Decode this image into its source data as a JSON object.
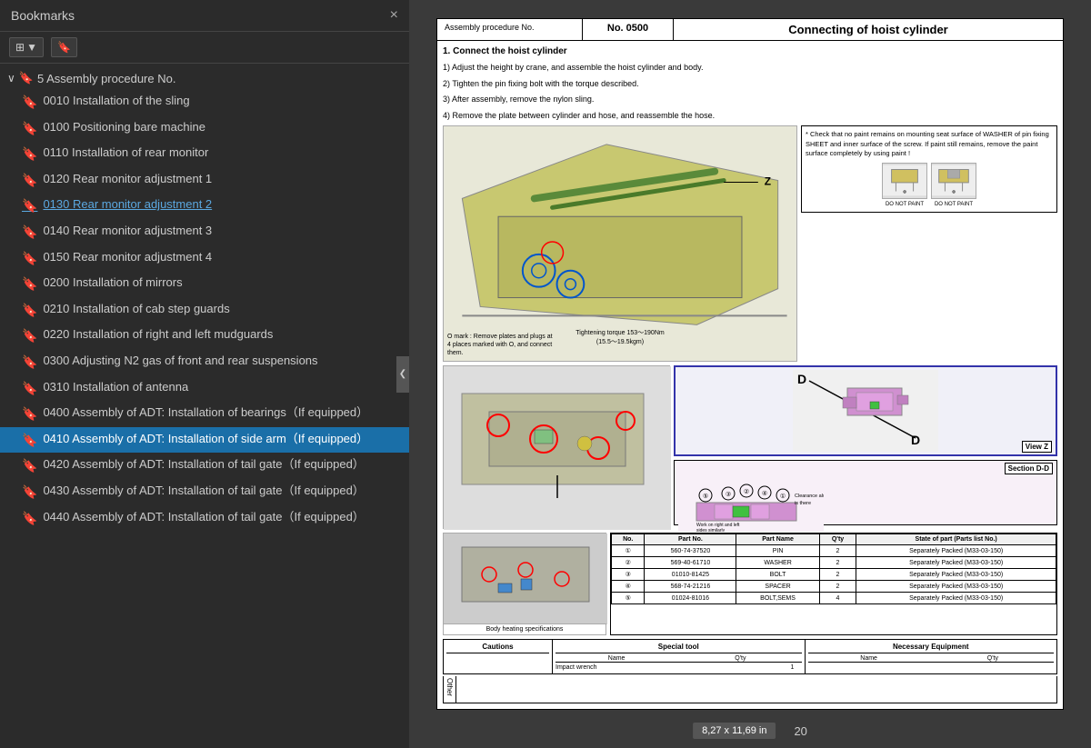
{
  "bookmarks": {
    "title": "Bookmarks",
    "close_label": "×",
    "root_label": "5 Assembly procedure No.",
    "items": [
      {
        "id": "b0010",
        "label": "0010 Installation of the sling",
        "active": false,
        "linked": false
      },
      {
        "id": "b0100",
        "label": "0100 Positioning bare machine",
        "active": false,
        "linked": false
      },
      {
        "id": "b0110",
        "label": "0110 Installation of rear monitor",
        "active": false,
        "linked": false
      },
      {
        "id": "b0120",
        "label": "0120 Rear monitor adjustment 1",
        "active": false,
        "linked": false
      },
      {
        "id": "b0130",
        "label": "0130 Rear monitor adjustment 2",
        "active": false,
        "linked": true
      },
      {
        "id": "b0140",
        "label": "0140 Rear monitor adjustment 3",
        "active": false,
        "linked": false
      },
      {
        "id": "b0150",
        "label": "0150 Rear monitor adjustment 4",
        "active": false,
        "linked": false
      },
      {
        "id": "b0200",
        "label": "0200 Installation of mirrors",
        "active": false,
        "linked": false
      },
      {
        "id": "b0210",
        "label": "0210 Installation of cab step guards",
        "active": false,
        "linked": false
      },
      {
        "id": "b0220",
        "label": "0220 Installation of right and left mudguards",
        "active": false,
        "linked": false
      },
      {
        "id": "b0300",
        "label": "0300 Adjusting N2 gas of front and rear suspensions",
        "active": false,
        "linked": false
      },
      {
        "id": "b0310",
        "label": "0310 Installation of antenna",
        "active": false,
        "linked": false
      },
      {
        "id": "b0400",
        "label": "0400 Assembly of ADT: Installation of bearings（If equipped）",
        "active": false,
        "linked": false
      },
      {
        "id": "b0410",
        "label": "0410 Assembly of ADT: Installation of side arm（If equipped）",
        "active": true,
        "linked": false
      },
      {
        "id": "b0420",
        "label": "0420 Assembly of ADT: Installation of tail gate（If equipped）",
        "active": false,
        "linked": false
      },
      {
        "id": "b0430",
        "label": "0430 Assembly of ADT: Installation of tail gate（If equipped）",
        "active": false,
        "linked": false
      },
      {
        "id": "b0440",
        "label": "0440 Assembly of ADT: Installation of tail gate（If equipped）",
        "active": false,
        "linked": false
      }
    ]
  },
  "document": {
    "header": {
      "proc_label": "Assembly procedure No.",
      "no_label": "No. 0500",
      "title": "Connecting of hoist cylinder"
    },
    "section1_title": "1. Connect the hoist cylinder",
    "instructions": [
      "1) Adjust the height by crane, and assemble the hoist cylinder and body.",
      "2) Tighten the pin fixing bolt with the torque described.",
      "3) After assembly, remove the nylon sling.",
      "4) Remove the plate between cylinder and hose, and reassemble the hose."
    ],
    "note_text": "* Check that no paint remains on mounting seat surface of WASHER of pin fixing SHEET and inner surface of the screw. If paint still remains, remove the paint surface completely by using paint !",
    "note_labels": [
      "DO NOT PAINT",
      "DO NOT PAINT"
    ],
    "torque_text": "Tightening torque  153～190Nm\n(15.5～19.5kgm)",
    "o_mark_text": "O mark : Remove plates and plugs at\n4 places marked with O, and connect\nthem.",
    "view_z_label": "View Z",
    "d_label": "D",
    "section_dd_label": "Section D-D",
    "clearance_text": "Clearance always\nis there",
    "work_text": "Work on right and left\nsides similarly",
    "body_heat_label": "Body heating specifications",
    "parts_table": {
      "headers": [
        "No.",
        "Part No.",
        "Part Name",
        "Q'ty",
        "State of part (Parts list No.)"
      ],
      "rows": [
        [
          "①",
          "560-74-37520",
          "PIN",
          "2",
          "Separately Packed (M33-03-150)"
        ],
        [
          "②",
          "569-40-61710",
          "WASHER",
          "2",
          "Separately Packed (M33-03-150)"
        ],
        [
          "③",
          "01010-81425",
          "BOLT",
          "2",
          "Separately Packed (M33-03-150)"
        ],
        [
          "④",
          "568-74-21216",
          "SPACER",
          "2",
          "Separately Packed (M33-03-150)"
        ],
        [
          "⑤",
          "01024-81016",
          "BOLT,SEMS",
          "4",
          "Separately Packed (M33-03-150)"
        ]
      ]
    },
    "cautions_label": "Cautions",
    "special_tool_label": "Special tool",
    "necessary_eq_label": "Necessary Equipment",
    "name_col": "Name",
    "qty_col": "Q'ty",
    "special_tool_row": "Impact wrench",
    "special_tool_qty": "1",
    "other_label": "Other",
    "page_size": "8,27 x 11,69 in",
    "page_number": "20"
  },
  "ui": {
    "collapse_icon": "❮",
    "expand_icon": "▶",
    "bookmark_icon": "🔖",
    "bookmark_outline": "⊘",
    "close_icon": "×",
    "toolbar_view_icon": "⊞",
    "toolbar_bookmark_icon": "🔖",
    "root_expand": "∨",
    "root_bookmark": "🔖"
  }
}
